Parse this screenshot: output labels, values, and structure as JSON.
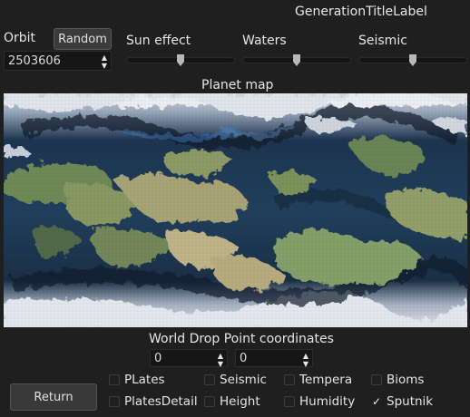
{
  "title": "GenerationTitleLabel",
  "orbit": {
    "label": "Orbit",
    "value": "2503606"
  },
  "random_button": "Random",
  "sliders": [
    {
      "label": "Sun effect",
      "value": 0.48
    },
    {
      "label": "Waters",
      "value": 0.47
    },
    {
      "label": "Seismic",
      "value": 0.47
    }
  ],
  "map": {
    "title": "Planet map"
  },
  "drop_point": {
    "title": "World Drop Point coordinates",
    "x": "0",
    "y": "0"
  },
  "return_button": "Return",
  "checkboxes": [
    {
      "label": "PLates",
      "checked": false
    },
    {
      "label": "Seismic",
      "checked": false
    },
    {
      "label": "Tempera",
      "checked": false
    },
    {
      "label": "Bioms",
      "checked": false
    },
    {
      "label": "PlatesDetail",
      "checked": false
    },
    {
      "label": "Height",
      "checked": false
    },
    {
      "label": "Humidity",
      "checked": false
    },
    {
      "label": "Sputnik",
      "checked": true
    }
  ]
}
